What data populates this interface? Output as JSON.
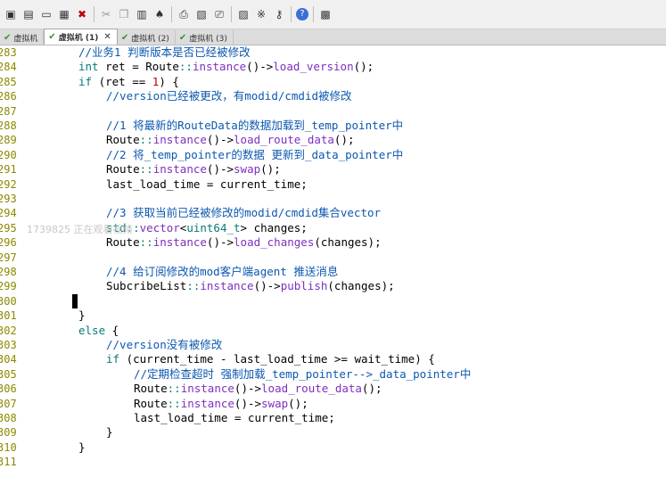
{
  "toolbar": {
    "icons": [
      "save-icon",
      "save-all-icon",
      "open-icon",
      "print-setup-icon",
      "close-icon",
      "cut-icon",
      "copy-icon",
      "paste-icon",
      "find-icon",
      "print-icon",
      "preview-icon",
      "print2-icon",
      "bookmark-icon",
      "settings-icon",
      "key-icon",
      "help-icon",
      "window-icon"
    ]
  },
  "tabs": [
    {
      "label": "虚拟机"
    },
    {
      "label": "虚拟机 (1)"
    },
    {
      "label": "虚拟机 (2)"
    },
    {
      "label": "虚拟机 (3)"
    }
  ],
  "watermark": "1739825 正在观看视频",
  "lines": [
    {
      "n": "283",
      "t": "//业务1 判断版本是否已经被修改"
    },
    {
      "n": "284",
      "t": "int ret = Route::instance()->load_version();"
    },
    {
      "n": "285",
      "t": "if (ret == 1) {"
    },
    {
      "n": "286",
      "t": "//version已经被更改，有modid/cmdid被修改"
    },
    {
      "n": "287",
      "t": ""
    },
    {
      "n": "288",
      "t": "//1 将最新的RouteData的数据加载到_temp_pointer中"
    },
    {
      "n": "289",
      "t": "Route::instance()->load_route_data();"
    },
    {
      "n": "290",
      "t": "//2 将_temp_pointer的数据 更新到_data_pointer中"
    },
    {
      "n": "291",
      "t": "Route::instance()->swap();"
    },
    {
      "n": "292",
      "t": "last_load_time = current_time;"
    },
    {
      "n": "293",
      "t": ""
    },
    {
      "n": "294",
      "t": "//3 获取当前已经被修改的modid/cmdid集合vector"
    },
    {
      "n": "295",
      "t": "std::vector<uint64_t> changes;"
    },
    {
      "n": "296",
      "t": "Route::instance()->load_changes(changes);"
    },
    {
      "n": "297",
      "t": ""
    },
    {
      "n": "298",
      "t": "//4 给订阅修改的mod客户端agent 推送消息"
    },
    {
      "n": "299",
      "t": "SubcribeList::instance()->publish(changes);"
    },
    {
      "n": "300",
      "t": ""
    },
    {
      "n": "301",
      "t": "}"
    },
    {
      "n": "302",
      "t": "else {"
    },
    {
      "n": "303",
      "t": "//version没有被修改"
    },
    {
      "n": "304",
      "t": "if (current_time - last_load_time >= wait_time) {"
    },
    {
      "n": "305",
      "t": "//定期检查超时 强制加载_temp_pointer-->_data_pointer中"
    },
    {
      "n": "306",
      "t": "Route::instance()->load_route_data();"
    },
    {
      "n": "307",
      "t": "Route::instance()->swap();"
    },
    {
      "n": "308",
      "t": "last_load_time = current_time;"
    },
    {
      "n": "309",
      "t": "}"
    },
    {
      "n": "310",
      "t": "}"
    },
    {
      "n": "311",
      "t": ""
    }
  ]
}
